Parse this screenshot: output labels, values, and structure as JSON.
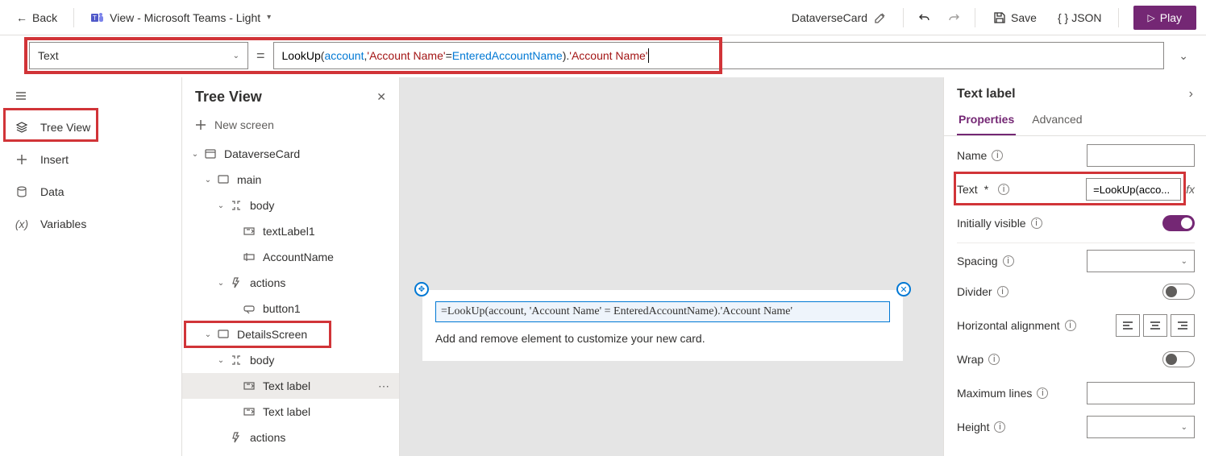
{
  "topbar": {
    "back_label": "Back",
    "view_label": "View - Microsoft Teams - Light",
    "card_name": "DataverseCard",
    "save_label": "Save",
    "json_label": "JSON",
    "play_label": "Play"
  },
  "formula": {
    "selected_property": "Text",
    "func": "LookUp",
    "datasource": "account",
    "str1": "'Account Name'",
    "op": " = ",
    "ident": "EnteredAccountName",
    "close": ").",
    "str2": "'Account Name'"
  },
  "leftrail": {
    "items": [
      {
        "label": "Tree View",
        "selected": true
      },
      {
        "label": "Insert",
        "selected": false
      },
      {
        "label": "Data",
        "selected": false
      },
      {
        "label": "Variables",
        "selected": false
      }
    ]
  },
  "tree": {
    "title": "Tree View",
    "new_screen_label": "New screen",
    "nodes": [
      {
        "label": "DataverseCard",
        "indent": 0,
        "icon": "card",
        "expanded": true
      },
      {
        "label": "main",
        "indent": 1,
        "icon": "screen",
        "expanded": true
      },
      {
        "label": "body",
        "indent": 2,
        "icon": "container",
        "expanded": true
      },
      {
        "label": "textLabel1",
        "indent": 3,
        "icon": "textlabel",
        "expanded": null
      },
      {
        "label": "AccountName",
        "indent": 3,
        "icon": "textinput",
        "expanded": null
      },
      {
        "label": "actions",
        "indent": 2,
        "icon": "actions",
        "expanded": true
      },
      {
        "label": "button1",
        "indent": 3,
        "icon": "button",
        "expanded": null
      },
      {
        "label": "DetailsScreen",
        "indent": 1,
        "icon": "screen",
        "expanded": true,
        "highlighted": true
      },
      {
        "label": "body",
        "indent": 2,
        "icon": "container",
        "expanded": true
      },
      {
        "label": "Text label",
        "indent": 3,
        "icon": "textlabel",
        "expanded": null,
        "selected": true
      },
      {
        "label": "Text label",
        "indent": 3,
        "icon": "textlabel",
        "expanded": null
      },
      {
        "label": "actions",
        "indent": 2,
        "icon": "actions",
        "expanded": null
      }
    ]
  },
  "canvas": {
    "selected_text": "=LookUp(account, 'Account Name' = EnteredAccountName).'Account Name'",
    "hint": "Add and remove element to customize your new card."
  },
  "proppanel": {
    "title": "Text label",
    "tabs": {
      "properties_label": "Properties",
      "advanced_label": "Advanced"
    },
    "name_label": "Name",
    "name_value": "",
    "text_label": "Text",
    "text_value": "=LookUp(acco...",
    "initially_visible_label": "Initially visible",
    "initially_visible": true,
    "spacing_label": "Spacing",
    "spacing_value": "",
    "divider_label": "Divider",
    "divider": false,
    "halign_label": "Horizontal alignment",
    "wrap_label": "Wrap",
    "wrap": false,
    "maxlines_label": "Maximum lines",
    "maxlines_value": "",
    "height_label": "Height",
    "height_value": ""
  }
}
